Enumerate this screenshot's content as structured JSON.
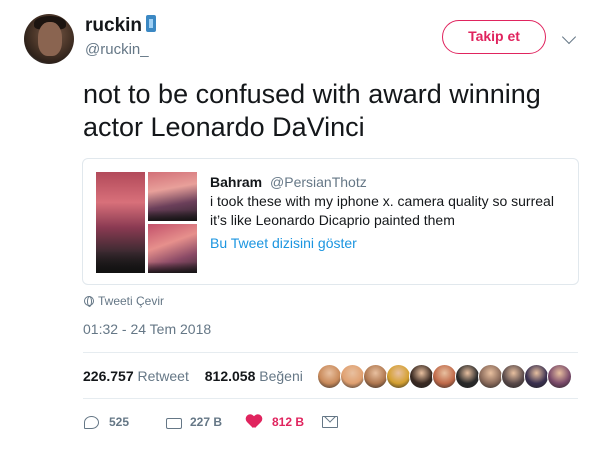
{
  "user": {
    "name": "ruckin",
    "handle": "@ruckin_",
    "follow_label": "Takip et"
  },
  "tweet": {
    "text": "not to be confused with award winning actor Leonardo DaVinci",
    "translate_label": "Tweeti Çevir",
    "timestamp": "01:32 - 24 Tem 2018"
  },
  "quoted_tweet": {
    "name": "Bahram",
    "handle": "@PersianThotz",
    "text": "i took these with my iphone x. camera quality so surreal it’s like Leonardo Dicaprio painted them",
    "thread_link": "Bu Tweet dizisini göster"
  },
  "stats": {
    "retweets_count": "226.757",
    "retweets_label": "Retweet",
    "likes_count": "812.058",
    "likes_label": "Beğeni"
  },
  "likers_colors": [
    "#c98a5a",
    "#e0a070",
    "#b07850",
    "#d4a030",
    "#3a2a22",
    "#c06a4a",
    "#2a2a2a",
    "#8a6a5a",
    "#5a4a4a",
    "#3a3050",
    "#7a4a6a"
  ],
  "actions": {
    "replies": "525",
    "retweets": "227 B",
    "likes": "812 B"
  },
  "colors": {
    "accent": "#e0245e",
    "link": "#1b95e0",
    "muted": "#657786"
  }
}
